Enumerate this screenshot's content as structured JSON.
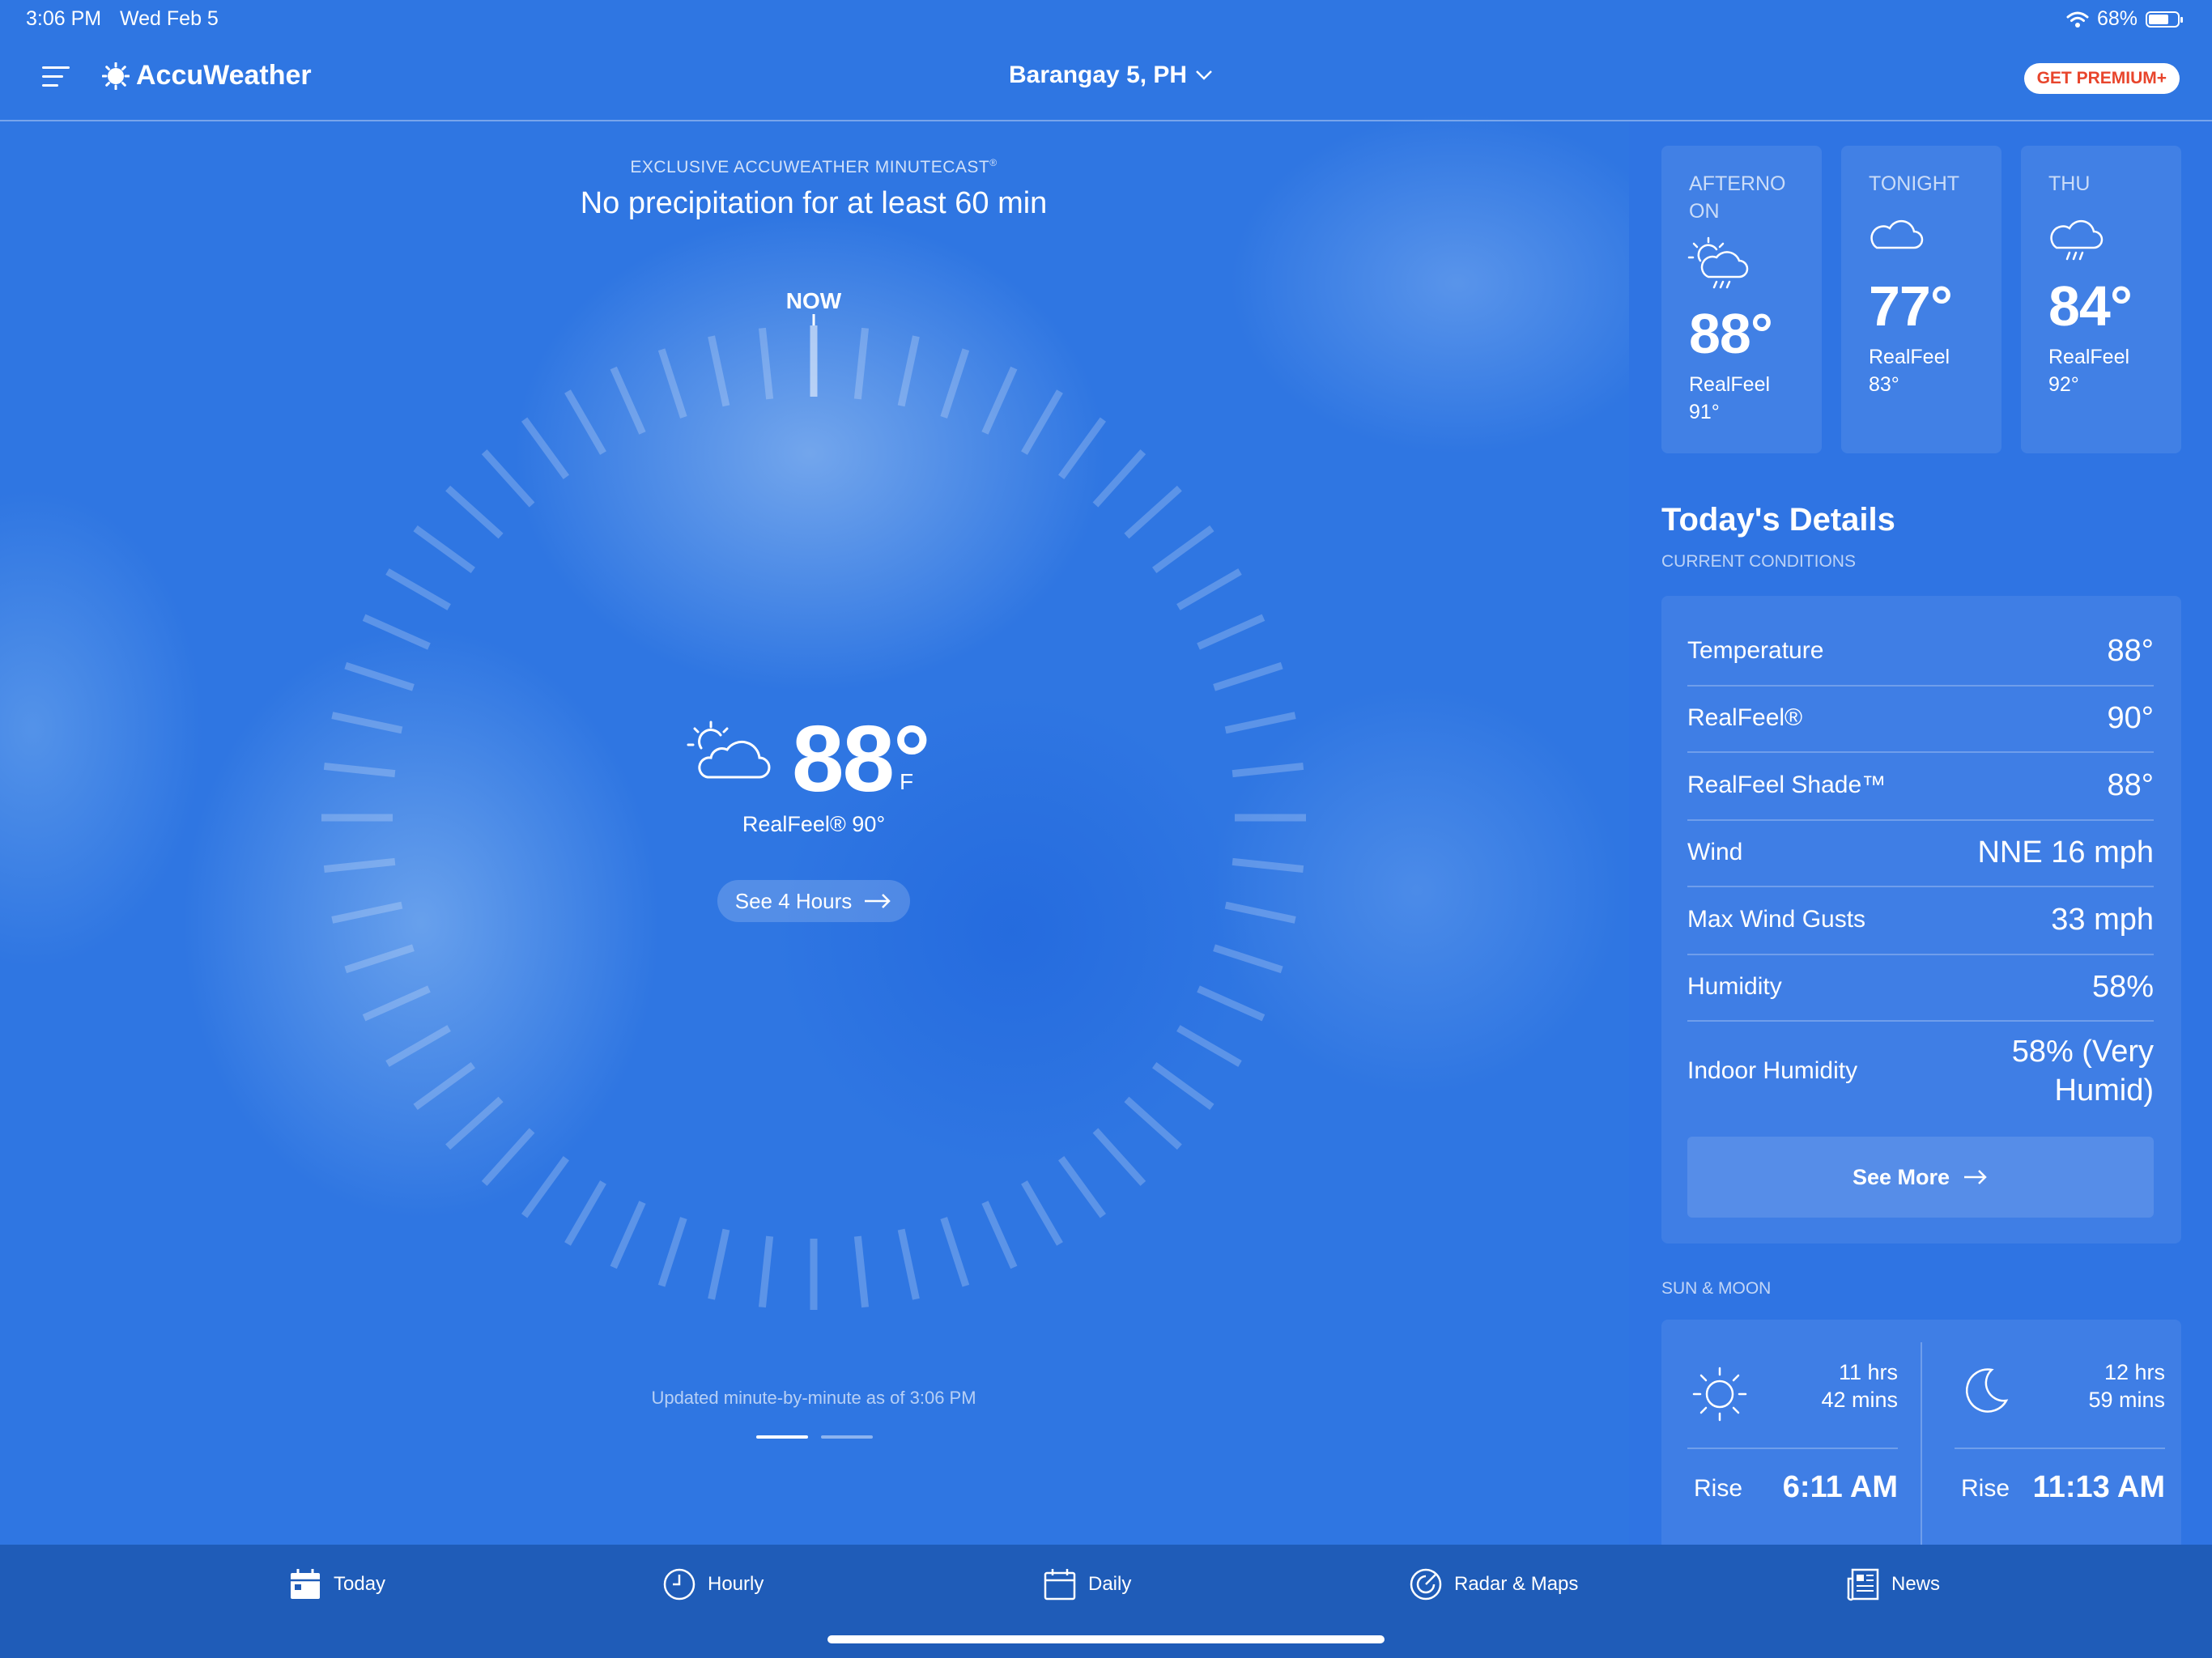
{
  "status_bar": {
    "time": "3:06 PM",
    "date": "Wed Feb 5",
    "battery": "68%"
  },
  "header": {
    "app_name": "AccuWeather",
    "location": "Barangay 5, PH",
    "premium_label": "GET PREMIUM+"
  },
  "minutecast": {
    "label": "EXCLUSIVE ACCUWEATHER MINUTECAST",
    "label_mark": "®",
    "summary": "No precipitation for at least 60 min",
    "now_label": "NOW",
    "updated_text": "Updated minute-by-minute as of 3:06 PM"
  },
  "current": {
    "temp": "88°",
    "unit": "F",
    "realfeel": "RealFeel® 90°",
    "see_hours": "See 4 Hours",
    "icon": "partly-sunny-icon"
  },
  "forecast_cards": [
    {
      "label": "AFTERNO ON",
      "icon": "sun-cloud-rain-icon",
      "temp": "88°",
      "realfeel_label": "RealFeel",
      "realfeel_value": "91°"
    },
    {
      "label": "TONIGHT",
      "icon": "cloud-icon",
      "temp": "77°",
      "realfeel_label": "RealFeel",
      "realfeel_value": "83°"
    },
    {
      "label": "THU",
      "icon": "cloud-rain-icon",
      "temp": "84°",
      "realfeel_label": "RealFeel",
      "realfeel_value": "92°"
    }
  ],
  "details": {
    "title": "Today's Details",
    "subtitle": "CURRENT CONDITIONS",
    "rows": [
      {
        "label": "Temperature",
        "value": "88°"
      },
      {
        "label": "RealFeel®",
        "value": "90°"
      },
      {
        "label": "RealFeel Shade™",
        "value": "88°"
      },
      {
        "label": "Wind",
        "value": "NNE 16 mph"
      },
      {
        "label": "Max Wind Gusts",
        "value": "33 mph"
      },
      {
        "label": "Humidity",
        "value": "58%"
      },
      {
        "label": "Indoor Humidity",
        "value_line1": "58% (Very",
        "value_line2": "Humid)"
      }
    ],
    "see_more": "See More"
  },
  "sun_moon": {
    "label": "SUN & MOON",
    "sun": {
      "dur_line1": "11 hrs",
      "dur_line2": "42 mins",
      "rise_label": "Rise",
      "rise_time": "6:11 AM"
    },
    "moon": {
      "dur_line1": "12 hrs",
      "dur_line2": "59 mins",
      "rise_label": "Rise",
      "rise_time": "11:13 AM"
    }
  },
  "tabs": [
    {
      "label": "Today",
      "icon": "calendar-today-icon"
    },
    {
      "label": "Hourly",
      "icon": "clock-icon"
    },
    {
      "label": "Daily",
      "icon": "calendar-icon"
    },
    {
      "label": "Radar & Maps",
      "icon": "radar-icon"
    },
    {
      "label": "News",
      "icon": "newspaper-icon"
    }
  ],
  "colors": {
    "background": "#2f76e2",
    "tab_bar": "#1f5cb8",
    "premium_text": "#e8452c"
  }
}
